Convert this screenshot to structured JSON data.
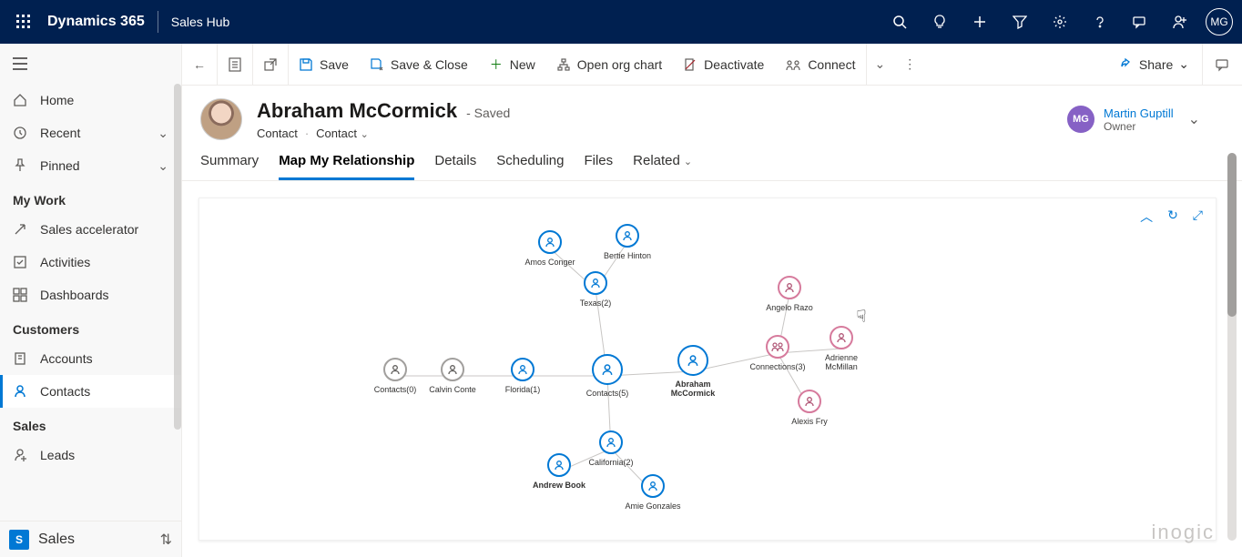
{
  "topbar": {
    "brand": "Dynamics 365",
    "app": "Sales Hub",
    "avatar_initials": "MG"
  },
  "sidebar": {
    "home": "Home",
    "recent": "Recent",
    "pinned": "Pinned",
    "section_mywork": "My Work",
    "sales_accel": "Sales accelerator",
    "activities": "Activities",
    "dashboards": "Dashboards",
    "section_customers": "Customers",
    "accounts": "Accounts",
    "contacts": "Contacts",
    "section_sales": "Sales",
    "leads": "Leads",
    "area_badge": "S",
    "area_label": "Sales"
  },
  "cmdbar": {
    "save": "Save",
    "save_close": "Save & Close",
    "new": "New",
    "open_org": "Open org chart",
    "deactivate": "Deactivate",
    "connect": "Connect",
    "share": "Share"
  },
  "record": {
    "title": "Abraham McCormick",
    "status": "- Saved",
    "entity": "Contact",
    "formname": "Contact"
  },
  "owner": {
    "initials": "MG",
    "name": "Martin Guptill",
    "role": "Owner"
  },
  "tabs": {
    "summary": "Summary",
    "map": "Map My Relationship",
    "details": "Details",
    "scheduling": "Scheduling",
    "files": "Files",
    "related": "Related"
  },
  "graph": {
    "contacts0": "Contacts(0)",
    "calvin": "Calvin Conte",
    "florida": "Florida(1)",
    "contacts5": "Contacts(5)",
    "abraham": "Abraham McCormick",
    "texas": "Texas(2)",
    "amos": "Amos Conger",
    "bertie": "Bertie Hinton",
    "california": "California(2)",
    "andrew": "Andrew Book",
    "amie": "Amie Gonzales",
    "connections": "Connections(3)",
    "angelo": "Angelo Razo",
    "adrienne": "Adrienne McMillan",
    "alexis": "Alexis Fry"
  },
  "watermark": "inogic"
}
